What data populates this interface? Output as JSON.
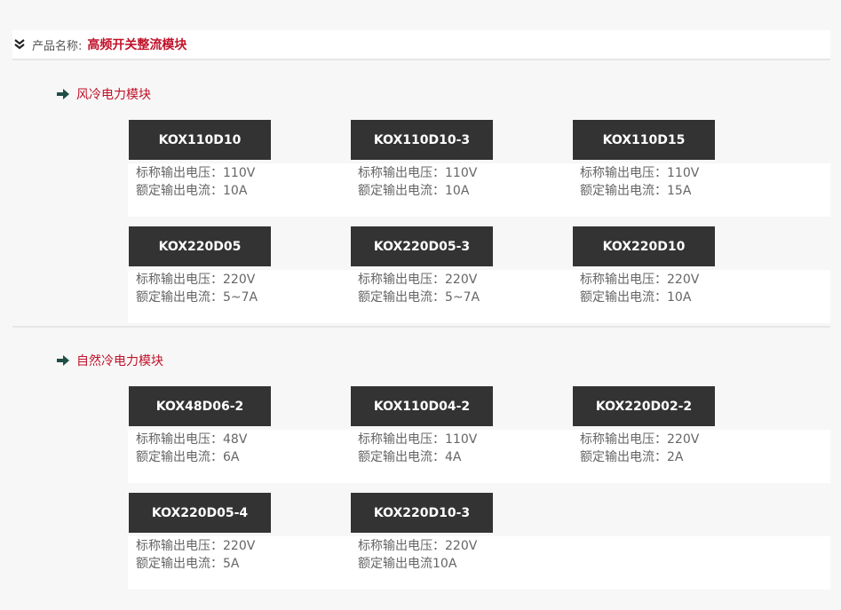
{
  "header": {
    "label": "产品名称:",
    "value": "高频开关整流模块"
  },
  "sections": [
    {
      "title": "风冷电力模块",
      "products": [
        {
          "name": "KOX110D10",
          "line1": "标称输出电压：110V",
          "line2": "额定输出电流：10A"
        },
        {
          "name": "KOX110D10-3",
          "line1": "标称输出电压：110V",
          "line2": "额定输出电流：10A"
        },
        {
          "name": "KOX110D15",
          "line1": "标称输出电压：110V",
          "line2": "额定输出电流：15A"
        },
        {
          "name": "KOX220D05",
          "line1": "标称输出电压：220V",
          "line2": "额定输出电流：5~7A"
        },
        {
          "name": "KOX220D05-3",
          "line1": "标称输出电压：220V",
          "line2": "额定输出电流：5~7A"
        },
        {
          "name": "KOX220D10",
          "line1": "标称输出电压：220V",
          "line2": "额定输出电流：10A"
        }
      ]
    },
    {
      "title": "自然冷电力模块",
      "products": [
        {
          "name": "KOX48D06-2",
          "line1": "标称输出电压：48V",
          "line2": "额定输出电流：6A"
        },
        {
          "name": "KOX110D04-2",
          "line1": "标称输出电压：110V",
          "line2": "额定输出电流：4A"
        },
        {
          "name": "KOX220D02-2",
          "line1": "标称输出电压：220V",
          "line2": "额定输出电流：2A"
        },
        {
          "name": "KOX220D05-4",
          "line1": "标称输出电压：220V",
          "line2": "额定输出电流：5A"
        },
        {
          "name": "KOX220D10-3",
          "line1": "标称输出电压：220V",
          "line2": "额定输出电流10A"
        }
      ]
    }
  ],
  "colors": {
    "accent": "#c0122a",
    "card_bg": "#333333",
    "arrow": "#1f4e45"
  },
  "icons": {
    "header": "double-chevron-down-icon",
    "section": "right-arrow-icon"
  }
}
